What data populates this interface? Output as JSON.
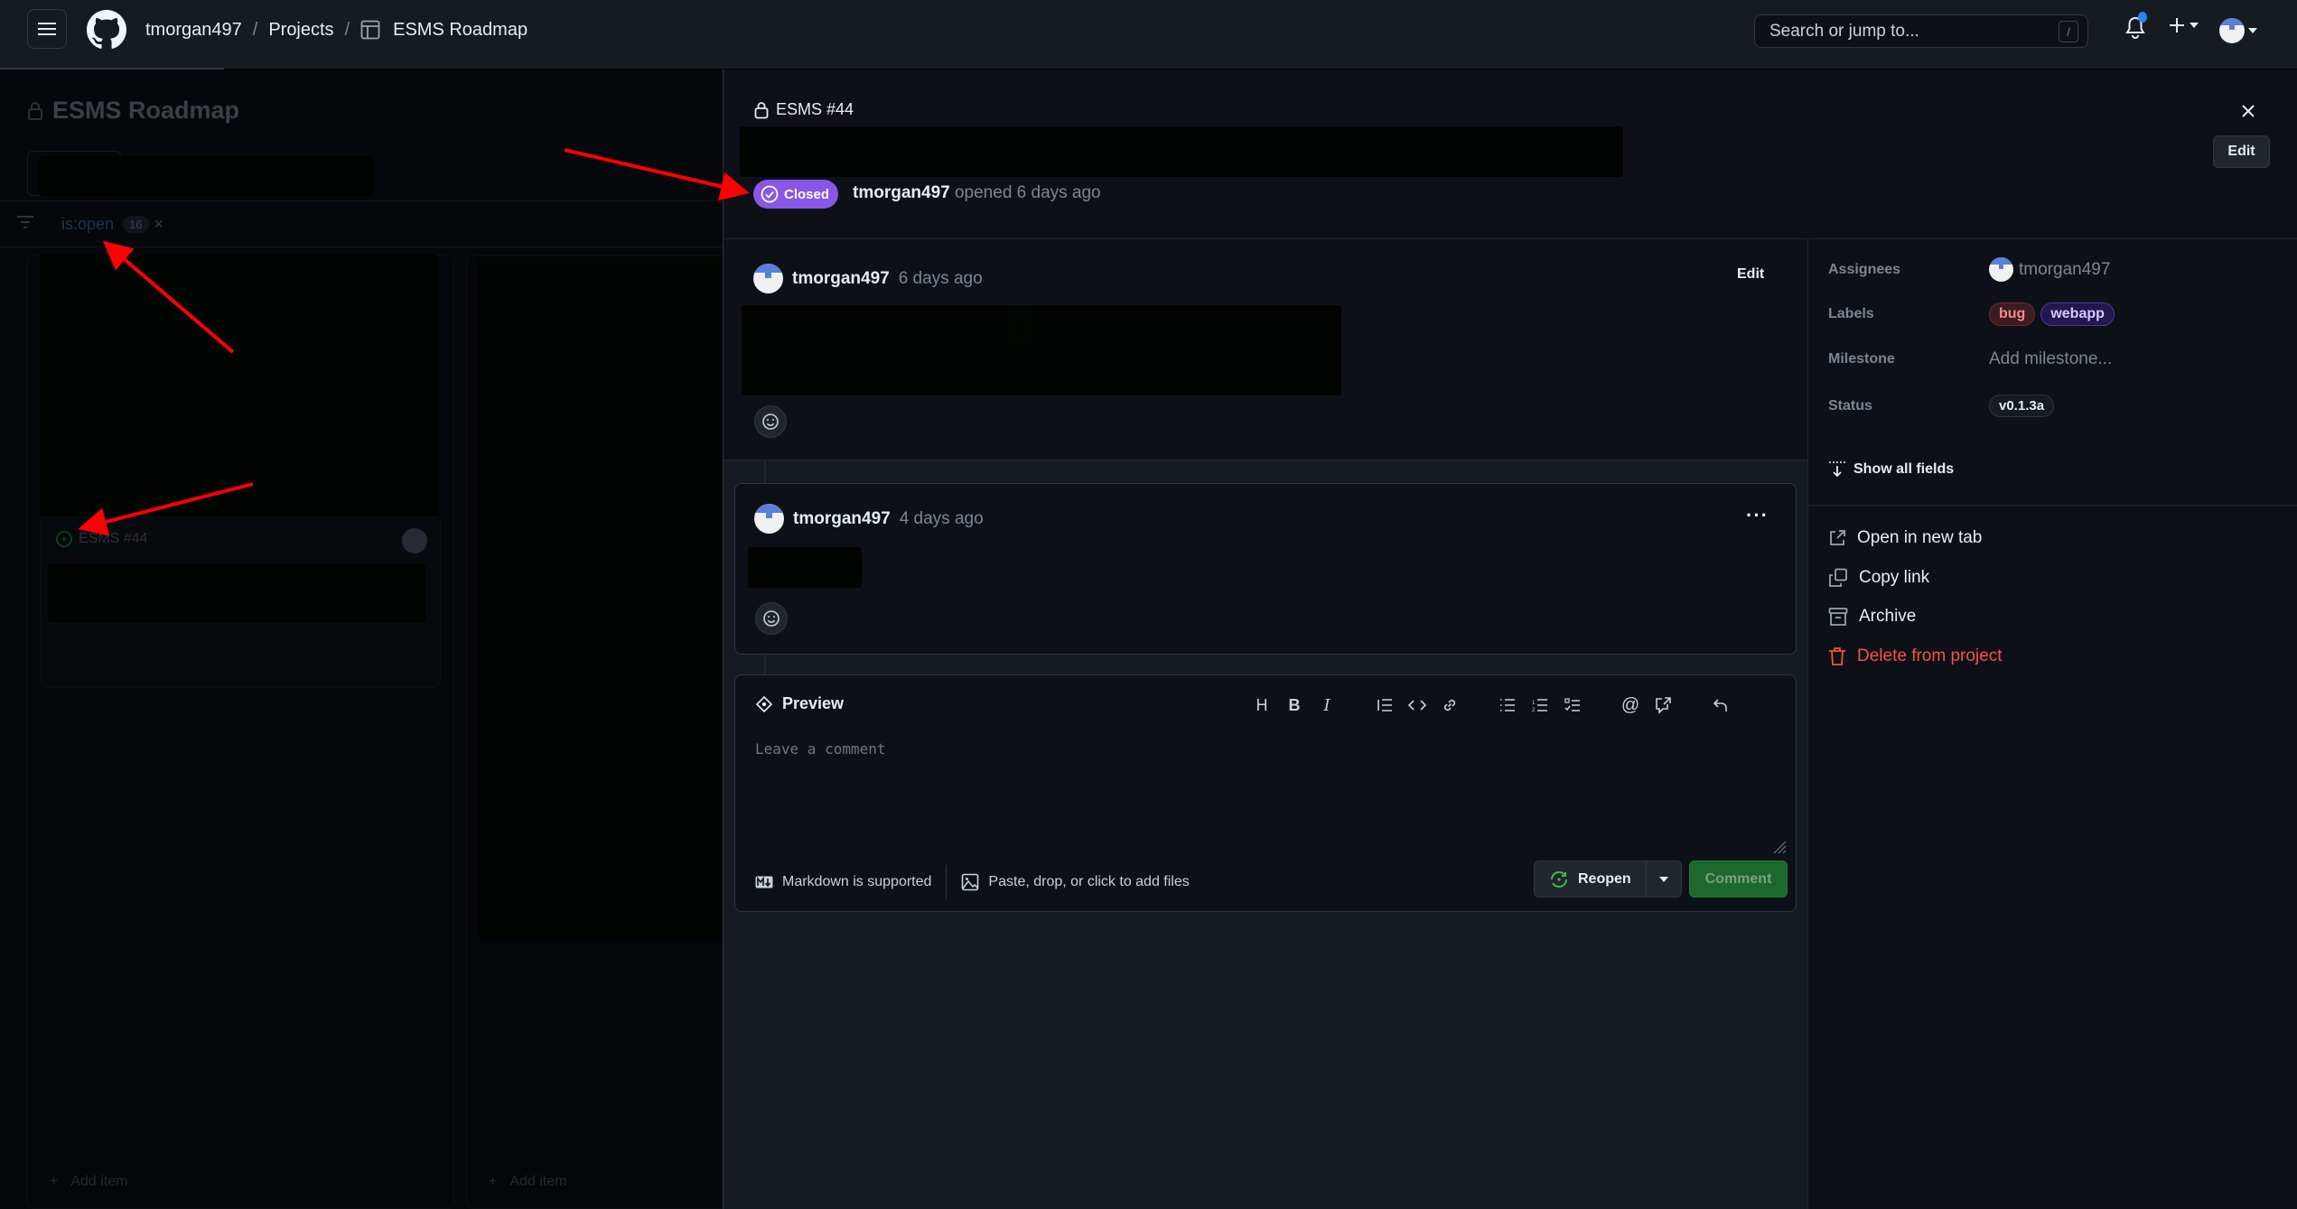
{
  "header": {
    "breadcrumb": [
      "tmorgan497",
      "Projects",
      "ESMS Roadmap"
    ],
    "separator": "/",
    "search_placeholder": "Search or jump to...",
    "search_shortcut": "/",
    "icons": [
      "hamburger-icon",
      "github-logo-icon",
      "project-table-icon",
      "bell-icon",
      "plus-icon",
      "avatar"
    ]
  },
  "board": {
    "title": "ESMS Roadmap",
    "filter": {
      "prefix": "is:",
      "value": "open",
      "count": "16",
      "clear": "×"
    },
    "card": {
      "ref": "ESMS #44"
    },
    "add_item_label": "Add item"
  },
  "panel": {
    "issue_ref": "ESMS #44",
    "state": "Closed",
    "state_color": "#8957e5",
    "author": "tmorgan497",
    "opened_text": "opened 6 days ago",
    "close_label": "×",
    "edit_label": "Edit",
    "comments": [
      {
        "author": "tmorgan497",
        "time": "6 days ago",
        "action": "Edit"
      },
      {
        "author": "tmorgan497",
        "time": "4 days ago",
        "action": "···"
      }
    ],
    "composer": {
      "tab": "Preview",
      "placeholder": "Leave a comment",
      "toolbar": [
        "heading",
        "bold",
        "italic",
        "quote",
        "code",
        "link",
        "unordered-list",
        "ordered-list",
        "task-list",
        "mention",
        "cross-reference",
        "undo"
      ],
      "markdown_note": "Markdown is supported",
      "files_note": "Paste, drop, or click to add files",
      "reopen_label": "Reopen",
      "comment_label": "Comment"
    }
  },
  "sidebar": {
    "fields": [
      {
        "label": "Assignees",
        "value": "tmorgan497"
      },
      {
        "label": "Labels",
        "values": [
          {
            "name": "bug",
            "color": "#f28b96"
          },
          {
            "name": "webapp",
            "color": "#d5c9ff"
          }
        ]
      },
      {
        "label": "Milestone",
        "value": "Add milestone..."
      },
      {
        "label": "Status",
        "value": "v0.1.3a"
      }
    ],
    "show_all_fields": "Show all fields",
    "actions": [
      {
        "label": "Open in new tab",
        "icon": "external-link-icon"
      },
      {
        "label": "Copy link",
        "icon": "copy-icon"
      },
      {
        "label": "Archive",
        "icon": "archive-icon"
      },
      {
        "label": "Delete from project",
        "icon": "trash-icon",
        "danger": true
      }
    ]
  },
  "annotations": {
    "arrow_color": "#ff0000",
    "count": 3
  }
}
